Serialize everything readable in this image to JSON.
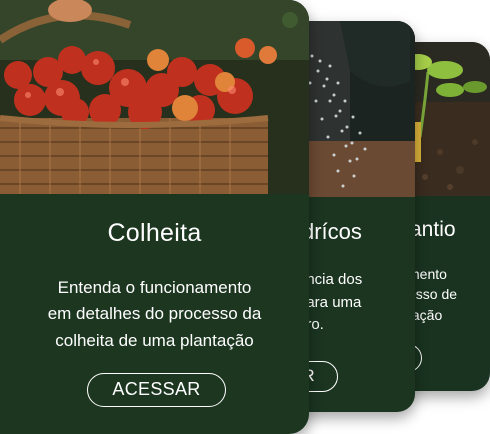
{
  "cards": [
    {
      "id": "colheita",
      "title": "Colheita",
      "description_lines": [
        "Entenda o funcionamento",
        "em detalhes do processo da",
        "colheita de uma plantação"
      ],
      "button_label": "ACESSAR",
      "image": "basket-of-tomatoes"
    },
    {
      "id": "hidricos",
      "title": "drícos",
      "description_lines": [
        "ância dos",
        "para uma",
        "gro."
      ],
      "button_label": "R",
      "image": "water-sprinkling"
    },
    {
      "id": "plantio",
      "title": "antio",
      "description_lines": [
        "mento",
        "esso de",
        "tação"
      ],
      "button_label": "",
      "image": "seedling-in-soil"
    }
  ],
  "colors": {
    "card_background": "#1c3620",
    "text": "#ffffff"
  }
}
